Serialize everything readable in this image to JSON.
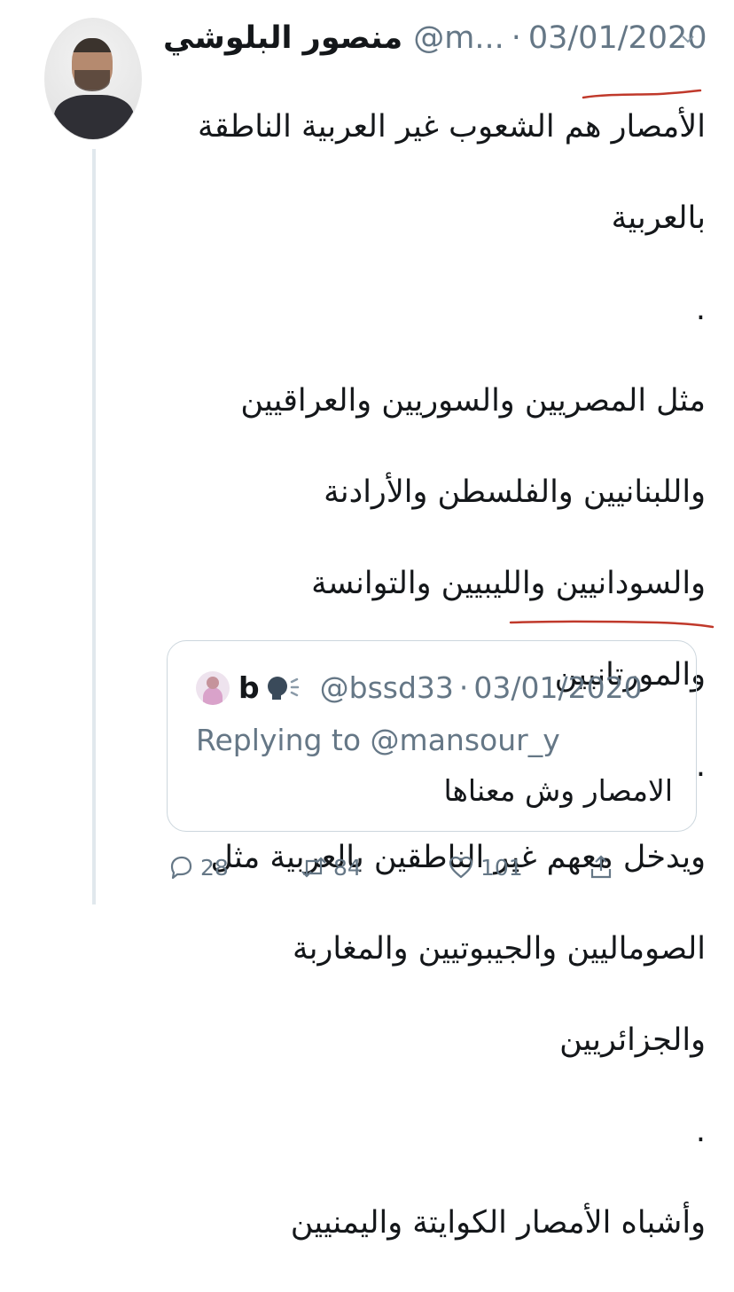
{
  "tweet": {
    "author_name": "منصور البلوشي",
    "handle": "@m...",
    "separator": "·",
    "date": "03/01/2020",
    "text_lines": [
      "الأمصار هم الشعوب غير العربية الناطقة",
      "بالعربية",
      ".",
      "مثل المصريين والسوريين والعراقيين",
      "واللبنانيين والفلسطن والأرادنة",
      "والسودانيين والليبيين والتوانسة",
      "والمورتانيين",
      ".",
      "ويدخل معهم غير الناطقين بالعربية مثل",
      "الصوماليين والجيبوتيين والمغاربة",
      "والجزائريين",
      ".",
      "وأشباه الأمصار الكوايتة واليمنيين"
    ],
    "underline_color": "#c0392b"
  },
  "quote": {
    "name": "b",
    "emoji": "speaking-head-icon",
    "handle": "@bssd33",
    "separator": "·",
    "date": "03/01/2020",
    "replying_prefix": "Replying to",
    "replying_to": "@mansour_y",
    "text": "الامصار وش معناها"
  },
  "actions": {
    "replies": "28",
    "retweets": "84",
    "likes": "101"
  },
  "colors": {
    "text": "#14171a",
    "muted": "#657786",
    "border": "#ccd6dd",
    "thread_line": "#e1e8ed"
  }
}
